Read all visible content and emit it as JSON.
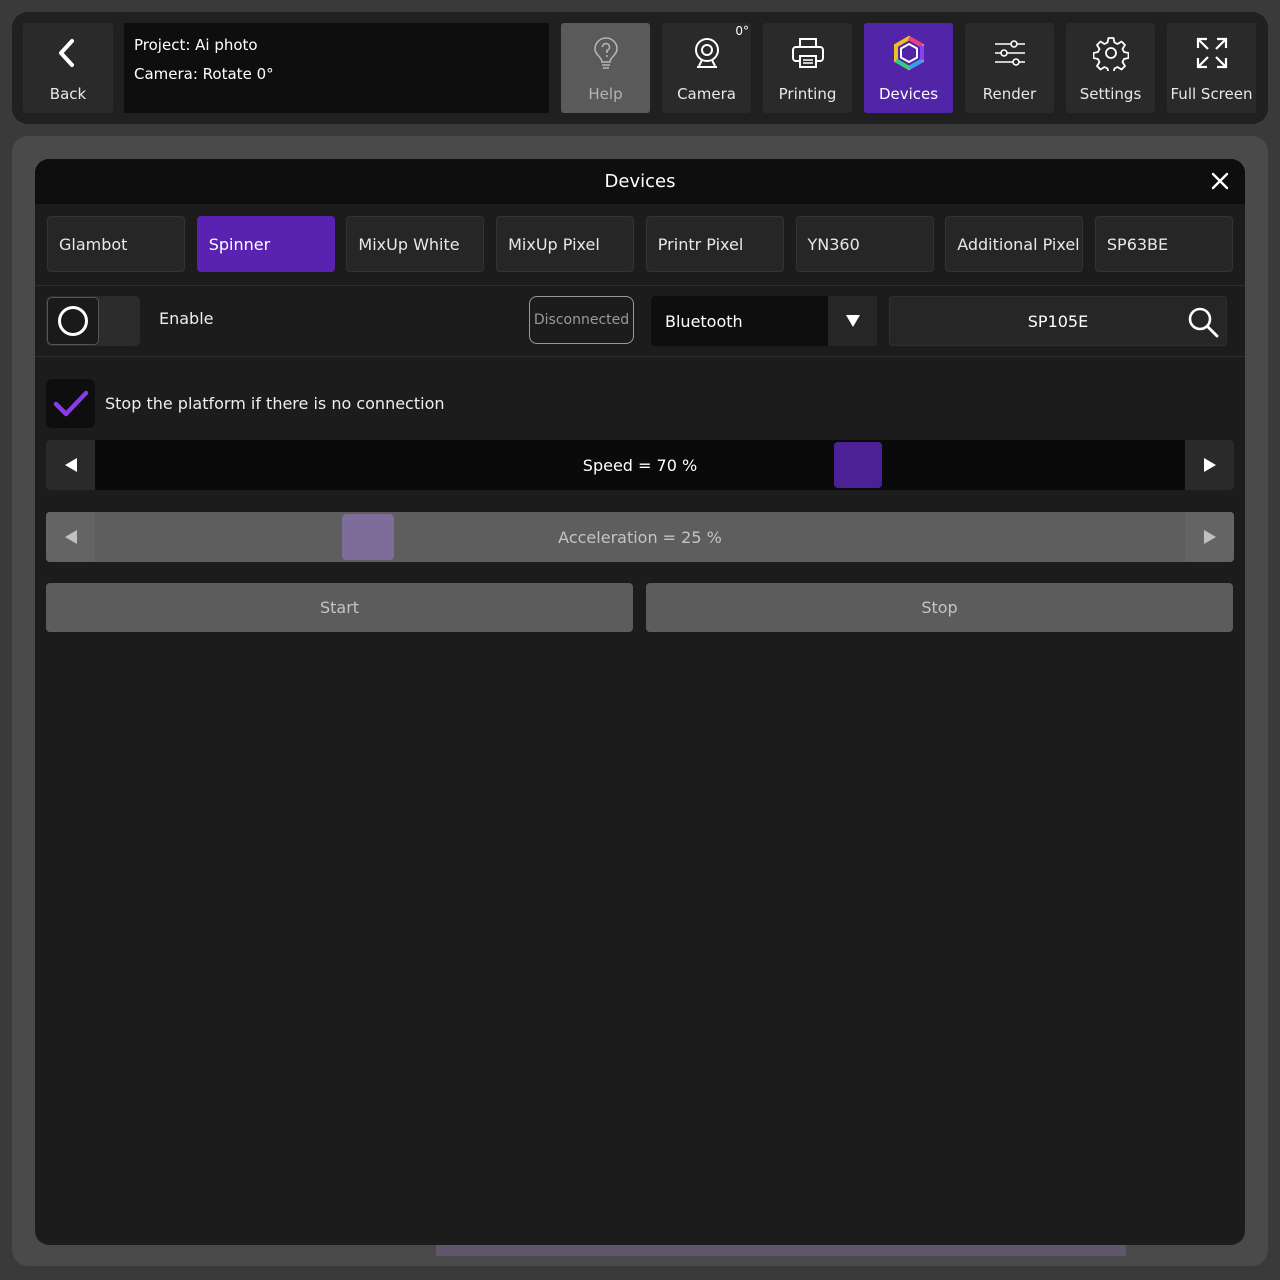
{
  "toolbar": {
    "back_label": "Back",
    "project_line": "Project: Ai photo",
    "camera_line": "Camera: Rotate 0°",
    "camera_rotation": "0°",
    "buttons": [
      {
        "label": "Help",
        "icon": "help-icon"
      },
      {
        "label": "Camera",
        "icon": "camera-icon"
      },
      {
        "label": "Printing",
        "icon": "printer-icon"
      },
      {
        "label": "Devices",
        "icon": "devices-icon"
      },
      {
        "label": "Render",
        "icon": "sliders-icon"
      },
      {
        "label": "Settings",
        "icon": "gear-icon"
      },
      {
        "label": "Full Screen",
        "icon": "fullscreen-icon"
      }
    ],
    "active": "Devices"
  },
  "modal": {
    "title": "Devices",
    "tabs": [
      "Glambot",
      "Spinner",
      "MixUp White",
      "MixUp Pixel",
      "Printr Pixel",
      "YN360",
      "Additional Pixel",
      "SP63BE"
    ],
    "active_tab": "Spinner",
    "enable_label": "Enable",
    "enabled": false,
    "status": "Disconnected",
    "connection_type": "Bluetooth",
    "device_name": "SP105E",
    "stop_on_disconnect_label": "Stop the platform if there is no connection",
    "stop_on_disconnect": true,
    "speed": {
      "label": "Speed =  70 %",
      "value": 70
    },
    "acceleration": {
      "label": "Acceleration = 25 %",
      "value": 25
    },
    "start_label": "Start",
    "stop_label": "Stop"
  },
  "colors": {
    "accent": "#5a22b0",
    "check": "#8a3ae8"
  }
}
